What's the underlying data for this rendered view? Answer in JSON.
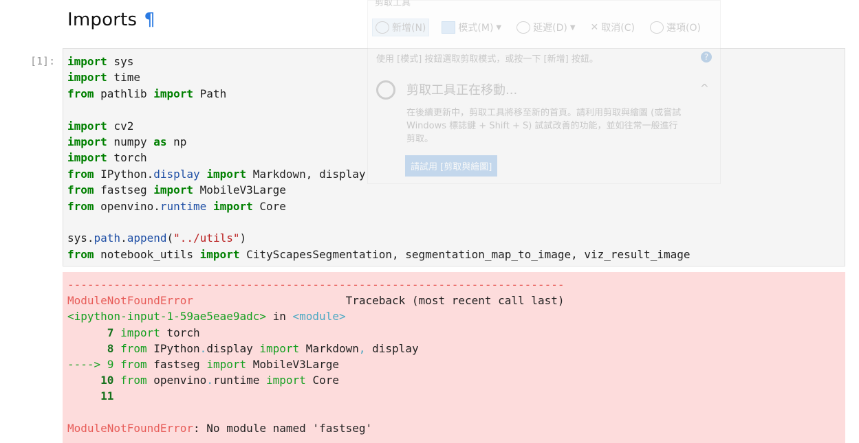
{
  "heading": {
    "title": "Imports",
    "anchor": "¶"
  },
  "cell": {
    "prompt": "[1]:",
    "lines": [
      [
        [
          "kw",
          "import"
        ],
        [
          "t",
          " sys"
        ]
      ],
      [
        [
          "kw",
          "import"
        ],
        [
          "t",
          " time"
        ]
      ],
      [
        [
          "kw",
          "from"
        ],
        [
          "t",
          " pathlib "
        ],
        [
          "kw",
          "import"
        ],
        [
          "t",
          " Path"
        ]
      ],
      [],
      [
        [
          "kw",
          "import"
        ],
        [
          "t",
          " cv2"
        ]
      ],
      [
        [
          "kw",
          "import"
        ],
        [
          "t",
          " numpy "
        ],
        [
          "kw",
          "as"
        ],
        [
          "t",
          " np"
        ]
      ],
      [
        [
          "kw",
          "import"
        ],
        [
          "t",
          " torch"
        ]
      ],
      [
        [
          "kw",
          "from"
        ],
        [
          "t",
          " IPython."
        ],
        [
          "mod",
          "display"
        ],
        [
          "t",
          " "
        ],
        [
          "kw",
          "import"
        ],
        [
          "t",
          " Markdown, display"
        ]
      ],
      [
        [
          "kw",
          "from"
        ],
        [
          "t",
          " fastseg "
        ],
        [
          "kw",
          "import"
        ],
        [
          "t",
          " MobileV3Large"
        ]
      ],
      [
        [
          "kw",
          "from"
        ],
        [
          "t",
          " openvino."
        ],
        [
          "mod",
          "runtime"
        ],
        [
          "t",
          " "
        ],
        [
          "kw",
          "import"
        ],
        [
          "t",
          " Core"
        ]
      ],
      [],
      [
        [
          "t",
          "sys."
        ],
        [
          "mod",
          "path"
        ],
        [
          "t",
          "."
        ],
        [
          "mod",
          "append"
        ],
        [
          "t",
          "("
        ],
        [
          "str",
          "\"../utils\""
        ],
        [
          "t",
          ")"
        ]
      ],
      [
        [
          "kw",
          "from"
        ],
        [
          "t",
          " notebook_utils "
        ],
        [
          "kw",
          "import"
        ],
        [
          "t",
          " CityScapesSegmentation, segmentation_map_to_image, viz_result_image"
        ]
      ]
    ]
  },
  "traceback": {
    "lines": [
      [
        [
          "err",
          "---------------------------------------------------------------------------"
        ]
      ],
      [
        [
          "err",
          "ModuleNotFoundError"
        ],
        [
          "t",
          "                       Traceback (most recent call last)"
        ]
      ],
      [
        [
          "grn",
          "<ipython-input-1-59ae5eae9adc>"
        ],
        [
          "t",
          " in "
        ],
        [
          "cyn",
          "<module>"
        ]
      ],
      [
        [
          "t",
          "      "
        ],
        [
          "ln",
          "7"
        ],
        [
          "t",
          " "
        ],
        [
          "grn",
          "import"
        ],
        [
          "t",
          " torch"
        ]
      ],
      [
        [
          "t",
          "      "
        ],
        [
          "ln",
          "8"
        ],
        [
          "t",
          " "
        ],
        [
          "grn",
          "from"
        ],
        [
          "t",
          " IPython"
        ],
        [
          "cyn",
          "."
        ],
        [
          "t",
          "display "
        ],
        [
          "grn",
          "import"
        ],
        [
          "t",
          " Markdown"
        ],
        [
          "cyn",
          ","
        ],
        [
          "t",
          " display"
        ]
      ],
      [
        [
          "grn",
          "----> 9"
        ],
        [
          "t",
          " "
        ],
        [
          "grn",
          "from"
        ],
        [
          "t",
          " fastseg "
        ],
        [
          "grn",
          "import"
        ],
        [
          "t",
          " MobileV3Large"
        ]
      ],
      [
        [
          "t",
          "     "
        ],
        [
          "ln",
          "10"
        ],
        [
          "t",
          " "
        ],
        [
          "grn",
          "from"
        ],
        [
          "t",
          " openvino"
        ],
        [
          "cyn",
          "."
        ],
        [
          "t",
          "runtime "
        ],
        [
          "grn",
          "import"
        ],
        [
          "t",
          " Core"
        ]
      ],
      [
        [
          "t",
          "     "
        ],
        [
          "ln",
          "11"
        ]
      ],
      [],
      [
        [
          "err",
          "ModuleNotFoundError"
        ],
        [
          "t",
          ": No module named 'fastseg'"
        ]
      ]
    ]
  },
  "snipping_tool": {
    "title": "剪取工具",
    "new_label": "新增(N)",
    "mode_label": "模式(M)",
    "delay_label": "延遲(D)",
    "cancel_label": "取消(C)",
    "options_label": "選項(O)",
    "hint": "使用 [模式] 按鈕選取剪取模式，或按一下 [新增] 按鈕。",
    "help": "?",
    "moving_title": "剪取工具正在移動...",
    "body": "在後續更新中，剪取工具將移至新的首頁。請利用剪取與繪圖 (或嘗試 Windows 標誌鍵 + Shift + S) 試試改善的功能，並如往常一般進行剪取。",
    "try_label": "請試用 [剪取與繪圖]",
    "collapse": "^"
  },
  "colors": {
    "keyword": "#008000",
    "error": "#e75c58",
    "output_bg": "#fddcdc",
    "input_bg": "#f5f5f5"
  }
}
